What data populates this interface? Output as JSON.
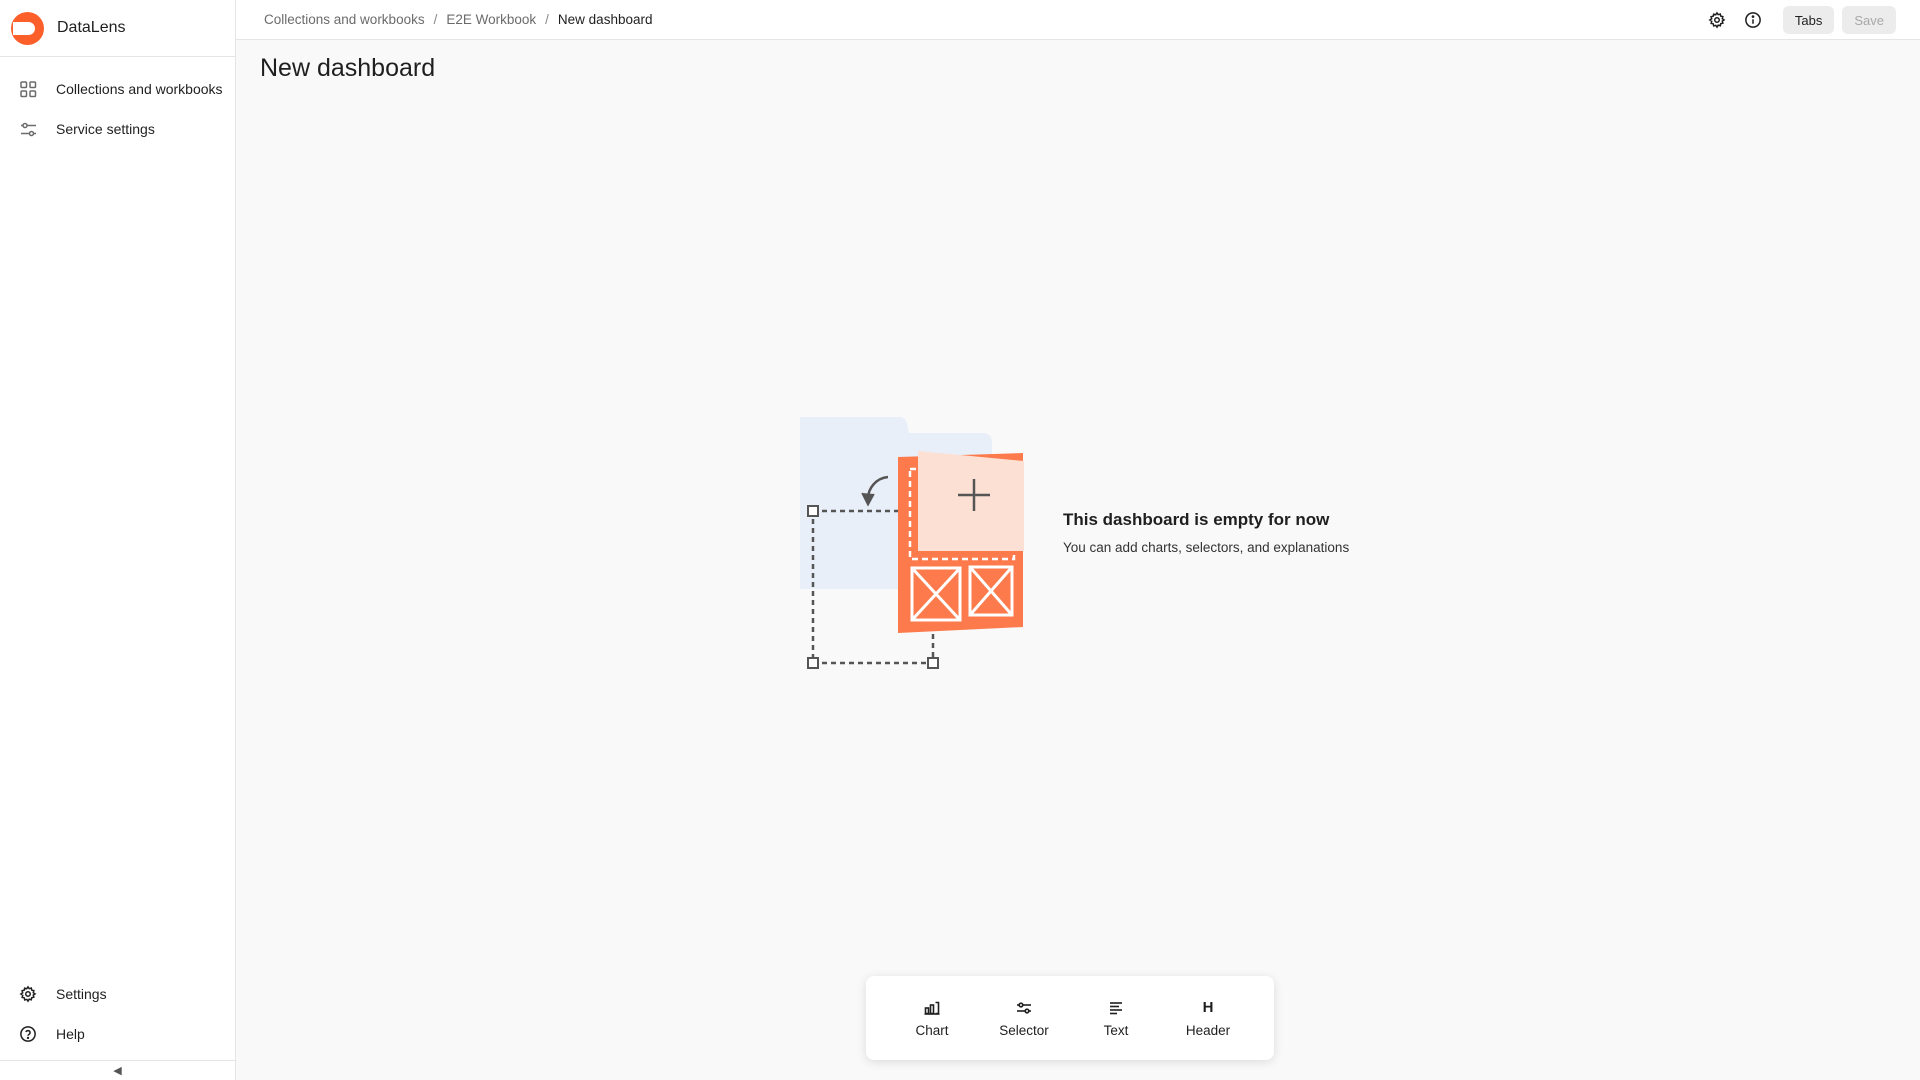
{
  "app": {
    "name": "DataLens",
    "brand_color": "#fc5f2a"
  },
  "sidebar": {
    "items": [
      {
        "label": "Collections and workbooks",
        "icon": "grid-icon"
      },
      {
        "label": "Service settings",
        "icon": "sliders-icon"
      }
    ],
    "bottom_items": [
      {
        "label": "Settings",
        "icon": "gear-icon"
      },
      {
        "label": "Help",
        "icon": "help-circle-icon"
      }
    ],
    "collapse_glyph": "◀"
  },
  "breadcrumb": {
    "items": [
      "Collections and workbooks",
      "E2E Workbook"
    ],
    "separator": "/",
    "current": "New dashboard"
  },
  "header_actions": {
    "icons": [
      "gear-icon",
      "info-icon"
    ],
    "tabs_label": "Tabs",
    "save_label": "Save"
  },
  "page": {
    "title": "New dashboard"
  },
  "empty_state": {
    "title": "This dashboard is empty for now",
    "subtitle": "You can add charts, selectors, and explanations"
  },
  "toolbar": {
    "items": [
      {
        "label": "Chart",
        "icon": "chart-icon"
      },
      {
        "label": "Selector",
        "icon": "selector-icon"
      },
      {
        "label": "Text",
        "icon": "text-icon"
      },
      {
        "label": "Header",
        "icon": "header-icon",
        "glyph": "H"
      }
    ]
  }
}
